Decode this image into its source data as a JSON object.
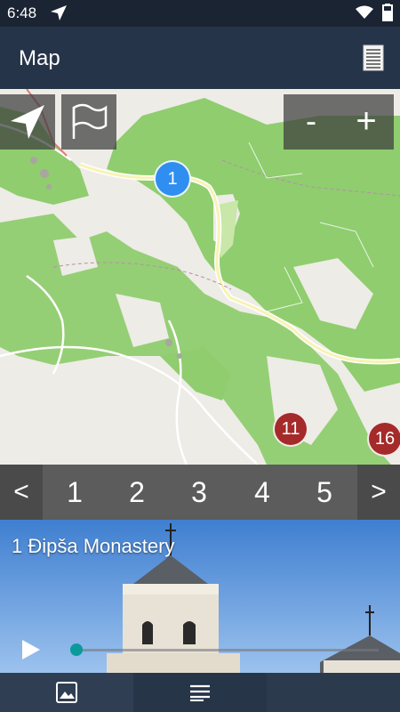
{
  "status": {
    "time": "6:48"
  },
  "appbar": {
    "title": "Map"
  },
  "map": {
    "zoom_out_label": "-",
    "zoom_in_label": "+",
    "markers": [
      "1",
      "11",
      "16"
    ]
  },
  "pager": {
    "prev_label": "<",
    "next_label": ">",
    "pages": [
      "1",
      "2",
      "3",
      "4",
      "5"
    ]
  },
  "stop": {
    "title": "1 Đipša Monastery",
    "audio_progress": 0.0
  },
  "icons": [
    "navigation-icon",
    "wifi-icon",
    "battery-icon",
    "list-icon",
    "locate-icon",
    "flag-icon",
    "play-icon",
    "image-icon",
    "text-list-icon"
  ]
}
